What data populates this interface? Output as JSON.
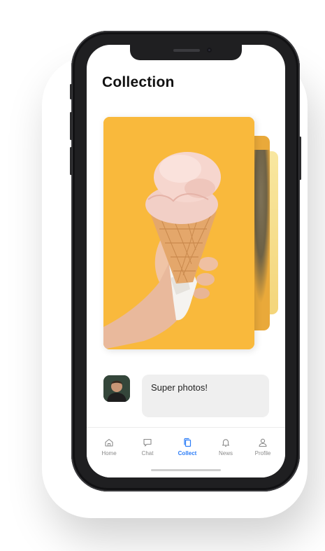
{
  "screen": {
    "title": "Collection"
  },
  "gallery": {
    "main_photo": "ice-cream-cone-photo",
    "stacked_photos": [
      "plant-photo",
      "yellow-photo"
    ],
    "background_color": "#f9b93c"
  },
  "comment": {
    "avatar": "user-avatar",
    "text": "Super photos!"
  },
  "tabbar": {
    "active_color": "#2b7cf7",
    "items": [
      {
        "label": "Home",
        "icon": "home-icon"
      },
      {
        "label": "Chat",
        "icon": "chat-icon"
      },
      {
        "label": "Collect",
        "icon": "collect-icon"
      },
      {
        "label": "News",
        "icon": "bell-icon"
      },
      {
        "label": "Profile",
        "icon": "profile-icon"
      }
    ]
  }
}
